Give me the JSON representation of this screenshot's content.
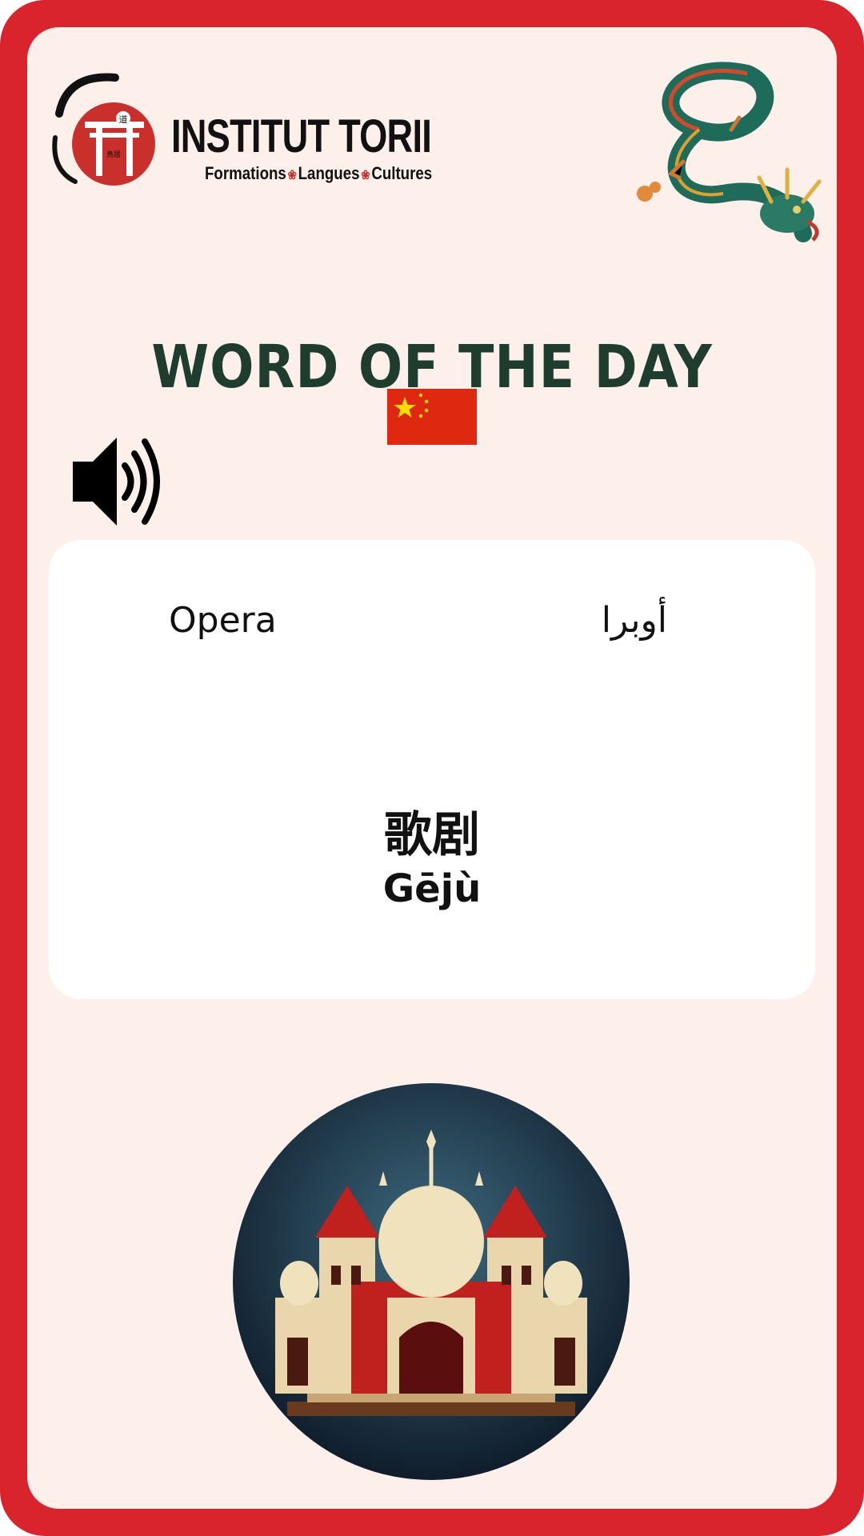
{
  "logo": {
    "name": "INSTITUT TORII",
    "tagline_parts": [
      "Formations",
      "Langues",
      "Cultures"
    ],
    "separator": "❀",
    "seal_text": "道",
    "pillar_text": "鳥居"
  },
  "header": {
    "title": "WORD OF THE DAY",
    "flag": "china-flag-icon"
  },
  "audio": {
    "icon": "speaker-icon"
  },
  "word": {
    "english": "Opera",
    "arabic": "أوبرا",
    "chinese": "歌剧",
    "pinyin": "Gējù"
  },
  "colors": {
    "frame": "#d9242e",
    "panel": "#fdf0eb",
    "title": "#1e3d2f",
    "card": "#ffffff"
  }
}
